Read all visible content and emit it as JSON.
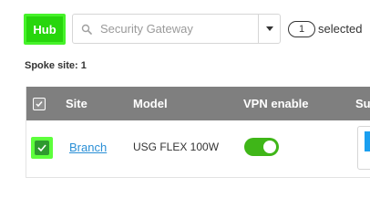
{
  "hub_button": {
    "label": "Hub"
  },
  "gateway_select": {
    "value": "Security Gateway"
  },
  "selection": {
    "count": "1",
    "suffix": "selected"
  },
  "spoke": {
    "label": "Spoke site: 1"
  },
  "table": {
    "columns": [
      "Site",
      "Model",
      "VPN enable",
      "Su"
    ],
    "rows": [
      {
        "site": "Branch",
        "model": "USG FLEX 100W",
        "vpn_enabled": true,
        "checked": true
      }
    ]
  },
  "colors": {
    "hub_green": "#27d60c",
    "header_gray": "#7f7f7f",
    "toggle_green": "#3fb618",
    "link_blue": "#2a8fd6"
  }
}
